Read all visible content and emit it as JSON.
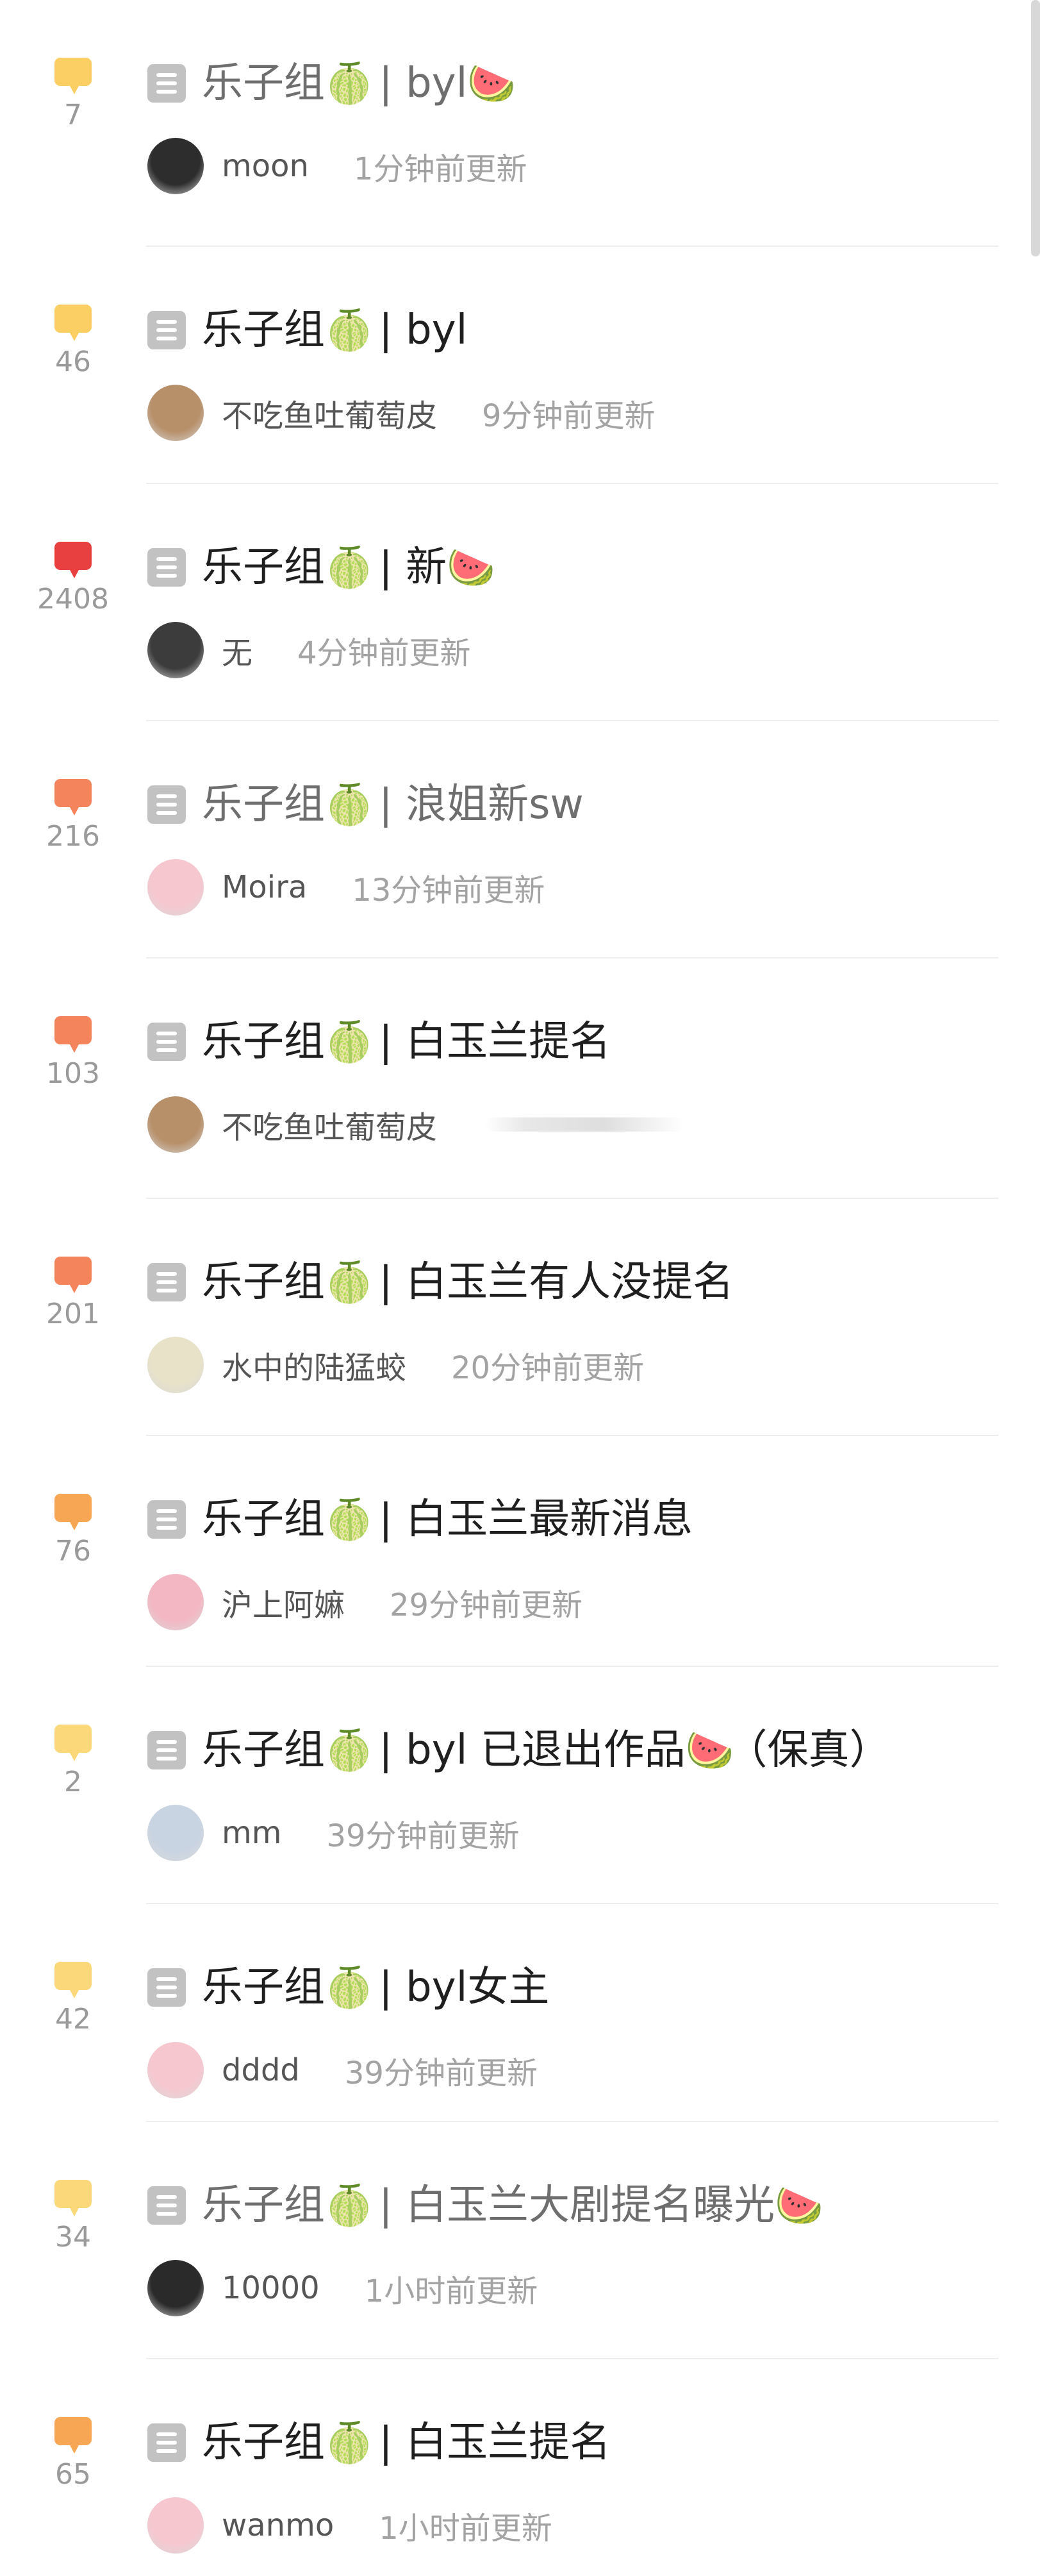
{
  "colors": {
    "bubble_yellow": "#fbcf64",
    "bubble_red": "#e84040",
    "bubble_orange": "#f4845c",
    "bubble_amber": "#f7a654",
    "bubble_light": "#fbd97a"
  },
  "posts": [
    {
      "count": "7",
      "bubble_color": "#fbcf64",
      "title": "乐子组",
      "melon": "🍈",
      "sep": "|",
      "topic": "byl",
      "trail": "🍉",
      "author": "moon",
      "time": "1分钟前更新",
      "avatar_color": "#2d2d2d",
      "avatar_icon": "avatar-photo"
    },
    {
      "count": "46",
      "bubble_color": "#fbcf64",
      "title": "乐子组",
      "melon": "🍈",
      "sep": "|",
      "topic": "byl",
      "trail": "",
      "author": "不吃鱼吐葡萄皮",
      "time": "9分钟前更新",
      "avatar_color": "#b7906a",
      "avatar_icon": "avatar-photo"
    },
    {
      "count": "2408",
      "bubble_color": "#e84040",
      "title": "乐子组",
      "melon": "🍈",
      "sep": "|",
      "topic": "新",
      "trail": "🍉",
      "author": "无",
      "time": "4分钟前更新",
      "avatar_color": "#3c3c3c",
      "avatar_icon": "avatar-photo"
    },
    {
      "count": "216",
      "bubble_color": "#f4845c",
      "title": "乐子组",
      "melon": "🍈",
      "sep": "|",
      "topic": "浪姐新sw",
      "trail": "",
      "author": "Moira",
      "time": "13分钟前更新",
      "avatar_color": "#f6c7cf",
      "avatar_icon": "avatar-photo"
    },
    {
      "count": "103",
      "bubble_color": "#f4845c",
      "title": "乐子组",
      "melon": "🍈",
      "sep": "|",
      "topic": "白玉兰提名",
      "trail": "",
      "author": "不吃鱼吐葡萄皮",
      "time": "",
      "avatar_color": "#b7906a",
      "avatar_icon": "avatar-photo"
    },
    {
      "count": "201",
      "bubble_color": "#f4845c",
      "title": "乐子组",
      "melon": "🍈",
      "sep": "|",
      "topic": "白玉兰有人没提名",
      "trail": "",
      "author": "水中的陆猛蛟",
      "time": "20分钟前更新",
      "avatar_color": "#e8e2c9",
      "avatar_icon": "avatar-photo"
    },
    {
      "count": "76",
      "bubble_color": "#f7a654",
      "title": "乐子组",
      "melon": "🍈",
      "sep": "|",
      "topic": "白玉兰最新消息",
      "trail": "",
      "author": "沪上阿嫲",
      "time": "29分钟前更新",
      "avatar_color": "#f3b7c3",
      "avatar_icon": "avatar-photo"
    },
    {
      "count": "2",
      "bubble_color": "#fbd97a",
      "title": "乐子组",
      "melon": "🍈",
      "sep": "|",
      "topic": "byl 已退出作品",
      "trail": "🍉",
      "extra": "（保真）",
      "author": "mm",
      "time": "39分钟前更新",
      "avatar_color": "#c9d4e2",
      "avatar_icon": "avatar-photo"
    },
    {
      "count": "42",
      "bubble_color": "#fbd97a",
      "title": "乐子组",
      "melon": "🍈",
      "sep": "|",
      "topic": "byl女主",
      "trail": "",
      "author": "dddd",
      "time": "39分钟前更新",
      "avatar_color": "#f6c7cf",
      "avatar_icon": "avatar-photo"
    },
    {
      "count": "34",
      "bubble_color": "#fbd97a",
      "title": "乐子组",
      "melon": "🍈",
      "sep": "|",
      "topic": "白玉兰大剧提名曝光",
      "trail": "🍉",
      "author": "10000",
      "time": "1小时前更新",
      "avatar_color": "#2a2a2a",
      "avatar_icon": "avatar-photo"
    },
    {
      "count": "65",
      "bubble_color": "#f7a654",
      "title": "乐子组",
      "melon": "🍈",
      "sep": "|",
      "topic": "白玉兰提名",
      "trail": "",
      "author": "wanmo",
      "time": "1小时前更新",
      "avatar_color": "#f6c7cf",
      "avatar_icon": "avatar-photo"
    }
  ]
}
